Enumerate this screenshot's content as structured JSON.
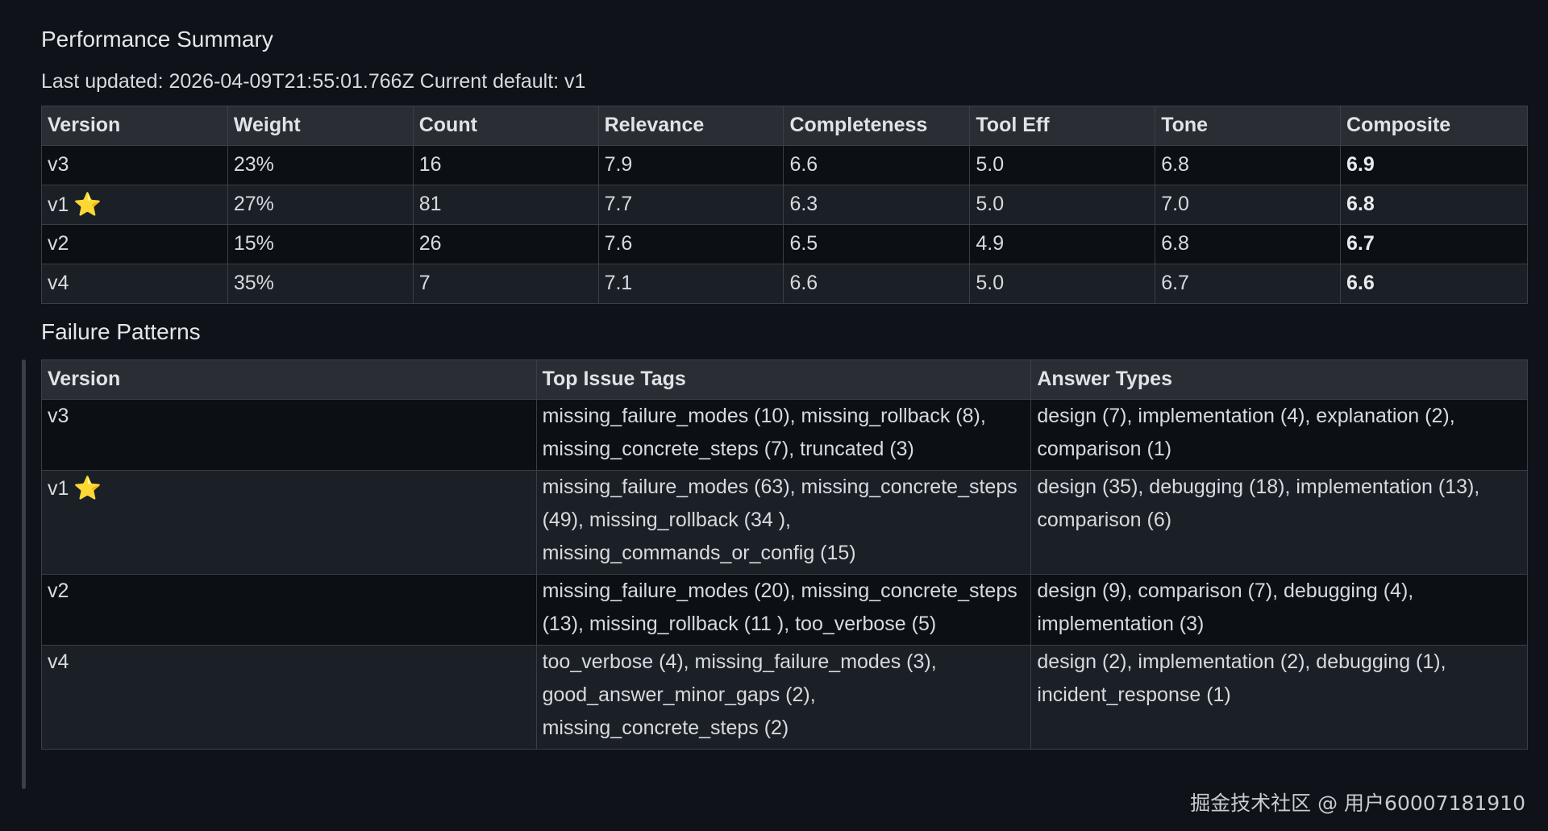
{
  "performance": {
    "title": "Performance Summary",
    "meta": "Last updated: 2026-04-09T21:55:01.766Z Current default: v1",
    "headers": [
      "Version",
      "Weight",
      "Count",
      "Relevance",
      "Completeness",
      "Tool Eff",
      "Tone",
      "Composite"
    ],
    "rows": [
      {
        "version": "v3",
        "star": false,
        "weight": "23%",
        "count": "16",
        "relevance": "7.9",
        "completeness": "6.6",
        "tool_eff": "5.0",
        "tone": "6.8",
        "composite": "6.9"
      },
      {
        "version": "v1",
        "star": true,
        "weight": "27%",
        "count": "81",
        "relevance": "7.7",
        "completeness": "6.3",
        "tool_eff": "5.0",
        "tone": "7.0",
        "composite": "6.8"
      },
      {
        "version": "v2",
        "star": false,
        "weight": "15%",
        "count": "26",
        "relevance": "7.6",
        "completeness": "6.5",
        "tool_eff": "4.9",
        "tone": "6.8",
        "composite": "6.7"
      },
      {
        "version": "v4",
        "star": false,
        "weight": "35%",
        "count": "7",
        "relevance": "7.1",
        "completeness": "6.6",
        "tool_eff": "5.0",
        "tone": "6.7",
        "composite": "6.6"
      }
    ]
  },
  "failures": {
    "title": "Failure Patterns",
    "headers": [
      "Version",
      "Top Issue Tags",
      "Answer Types"
    ],
    "rows": [
      {
        "version": "v3",
        "star": false,
        "tags": "missing_failure_modes (10), missing_rollback (8), missing_concrete_steps (7), truncated (3)",
        "answers": "design (7), implementation (4), explanation (2), comparison (1)"
      },
      {
        "version": "v1",
        "star": true,
        "tags": "missing_failure_modes (63), missing_concrete_steps (49), missing_rollback (34 ), missing_commands_or_config (15)",
        "answers": "design (35), debugging (18), implementation (13), comparison (6)"
      },
      {
        "version": "v2",
        "star": false,
        "tags": "missing_failure_modes (20), missing_concrete_steps (13), missing_rollback (11 ), too_verbose (5)",
        "answers": "design (9), comparison (7), debugging (4), implementation (3)"
      },
      {
        "version": "v4",
        "star": false,
        "tags": "too_verbose (4), missing_failure_modes (3), good_answer_minor_gaps (2), missing_concrete_steps (2)",
        "answers": "design (2), implementation (2), debugging (1), incident_response (1)"
      }
    ]
  },
  "star_glyph": "⭐",
  "watermark": "掘金技术社区 @ 用户60007181910"
}
